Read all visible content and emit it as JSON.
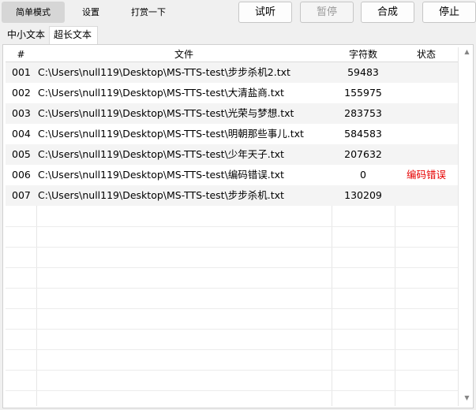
{
  "mode_tabs": [
    {
      "label": "简单模式",
      "active": true
    },
    {
      "label": "设置",
      "active": false
    },
    {
      "label": "打赏一下",
      "active": false
    }
  ],
  "buttons": {
    "listen": "试听",
    "pause": "暂停",
    "synthesize": "合成",
    "stop": "停止"
  },
  "sub_tabs": [
    {
      "label": "中小文本",
      "active": false
    },
    {
      "label": "超长文本",
      "active": true
    }
  ],
  "table": {
    "headers": {
      "num": "#",
      "file": "文件",
      "chars": "字符数",
      "status": "状态"
    },
    "rows": [
      {
        "num": "001",
        "file": "C:\\Users\\null119\\Desktop\\MS-TTS-test\\步步杀机2.txt",
        "chars": "59483",
        "status": ""
      },
      {
        "num": "002",
        "file": "C:\\Users\\null119\\Desktop\\MS-TTS-test\\大清盐商.txt",
        "chars": "155975",
        "status": ""
      },
      {
        "num": "003",
        "file": "C:\\Users\\null119\\Desktop\\MS-TTS-test\\光荣与梦想.txt",
        "chars": "283753",
        "status": ""
      },
      {
        "num": "004",
        "file": "C:\\Users\\null119\\Desktop\\MS-TTS-test\\明朝那些事儿.txt",
        "chars": "584583",
        "status": ""
      },
      {
        "num": "005",
        "file": "C:\\Users\\null119\\Desktop\\MS-TTS-test\\少年天子.txt",
        "chars": "207632",
        "status": ""
      },
      {
        "num": "006",
        "file": "C:\\Users\\null119\\Desktop\\MS-TTS-test\\编码错误.txt",
        "chars": "0",
        "status": "编码错误"
      },
      {
        "num": "007",
        "file": "C:\\Users\\null119\\Desktop\\MS-TTS-test\\步步杀机.txt",
        "chars": "130209",
        "status": ""
      }
    ]
  },
  "colors": {
    "error": "#e60000",
    "disabled": "#9b9b9b"
  },
  "icons": {
    "scroll_up": "scroll-up-arrow-icon",
    "scroll_down": "scroll-down-arrow-icon"
  }
}
